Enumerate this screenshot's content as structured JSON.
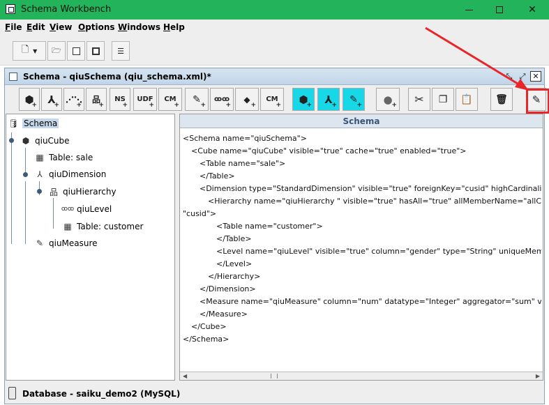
{
  "window": {
    "title": "Schema Workbench"
  },
  "menubar": {
    "items": [
      "File",
      "Edit",
      "View",
      "Options",
      "Windows",
      "Help"
    ]
  },
  "frame": {
    "title": "Schema - qiuSchema (qiu_schema.xml)*"
  },
  "schema_toolbar": {
    "labels": {
      "ns": "NS",
      "udf": "UDF",
      "cm": "CM",
      "cm2": "CM"
    }
  },
  "tree": {
    "nodes": [
      {
        "label": "Schema",
        "icon": "database-icon"
      },
      {
        "label": "qiuCube",
        "icon": "cube-icon"
      },
      {
        "label": "Table: sale",
        "icon": "table-icon"
      },
      {
        "label": "qiuDimension",
        "icon": "dimension-icon"
      },
      {
        "label": "qiuHierarchy",
        "icon": "hierarchy-icon"
      },
      {
        "label": "qiuLevel",
        "icon": "level-icon"
      },
      {
        "label": "Table: customer",
        "icon": "table-icon"
      },
      {
        "label": "qiuMeasure",
        "icon": "measure-icon"
      }
    ]
  },
  "xml": {
    "header": "Schema",
    "lines": [
      "<Schema name=\"qiuSchema\">",
      "<Cube name=\"qiuCube\" visible=\"true\" cache=\"true\" enabled=\"true\">",
      "<Table name=\"sale\">",
      "</Table>",
      "<Dimension type=\"StandardDimension\" visible=\"true\" foreignKey=\"cusid\" highCardinality=",
      "<Hierarchy name=\"qiuHierarchy \" visible=\"true\" hasAll=\"true\" allMemberName=\"allCous",
      "\"cusid\">",
      "<Table name=\"customer\">",
      "</Table>",
      "<Level name=\"qiuLevel\" visible=\"true\" column=\"gender\" type=\"String\" uniqueMembers",
      "</Level>",
      "</Hierarchy>",
      "</Dimension>",
      "<Measure name=\"qiuMeasure\" column=\"num\" datatype=\"Integer\" aggregator=\"sum\" visibl",
      "</Measure>",
      "</Cube>",
      "</Schema>"
    ]
  },
  "status": {
    "database": "Database - saiku_demo2 (MySQL)"
  },
  "colors": {
    "titlebar": "#23b35b",
    "annotation": "#e8262a",
    "selection": "#c7d7ea",
    "cyan_button": "#18d8e8"
  }
}
